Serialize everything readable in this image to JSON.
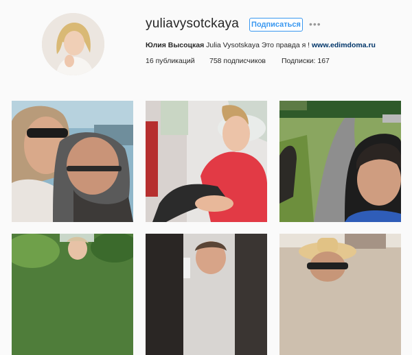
{
  "profile": {
    "username": "yuliavysotckaya",
    "follow_label": "Подписаться",
    "more_label": "•••",
    "full_name": "Юлия Высоцкая",
    "bio_text": "Julia Vysotskaya Это правда я !",
    "website": "www.edimdoma.ru"
  },
  "stats": {
    "posts": "16 публикаций",
    "followers": "758 подписчиков",
    "following": "Подписки: 167"
  },
  "posts": [
    {
      "name": "selfie-couple-sunglasses"
    },
    {
      "name": "woman-red-shirt-sitting"
    },
    {
      "name": "path-selfie"
    },
    {
      "name": "garden-portrait"
    },
    {
      "name": "formal-portrait"
    },
    {
      "name": "hat-selfie"
    }
  ],
  "colors": {
    "accent": "#3897f0",
    "link": "#003569",
    "background": "#fafafa"
  }
}
